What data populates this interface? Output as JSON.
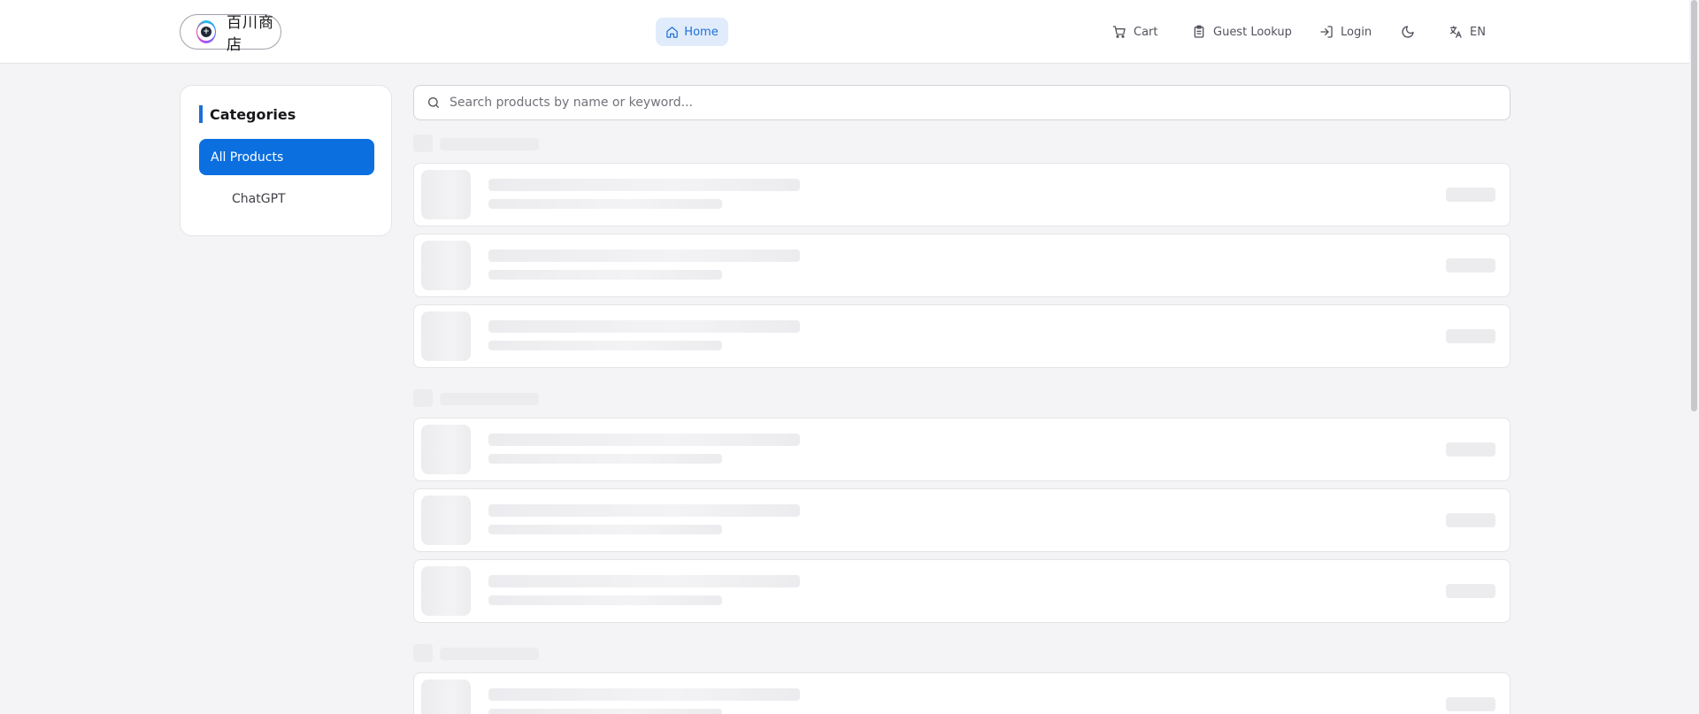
{
  "header": {
    "logo_text": "百川商店",
    "nav": {
      "home": "Home",
      "cart": "Cart",
      "guest_lookup": "Guest Lookup",
      "login": "Login",
      "language": "EN"
    }
  },
  "sidebar": {
    "title": "Categories",
    "items": [
      {
        "label": "All Products",
        "active": true
      },
      {
        "label": "ChatGPT",
        "active": false
      }
    ]
  },
  "search": {
    "placeholder": "Search products by name or keyword...",
    "value": ""
  },
  "loading_groups": [
    {
      "placeholder_cards": 3
    },
    {
      "placeholder_cards": 3
    },
    {
      "placeholder_cards": 1
    }
  ],
  "colors": {
    "accent": "#0b6fdf",
    "home_bg": "#e0ecfb",
    "page_bg": "#f4f4f6",
    "skeleton": "#ececef"
  },
  "icons": {
    "logo": "logo-icon",
    "home": "home-icon",
    "cart": "cart-icon",
    "guest_lookup": "clipboard-icon",
    "login": "login-icon",
    "theme": "moon-icon",
    "language": "translate-icon",
    "search": "search-icon"
  }
}
